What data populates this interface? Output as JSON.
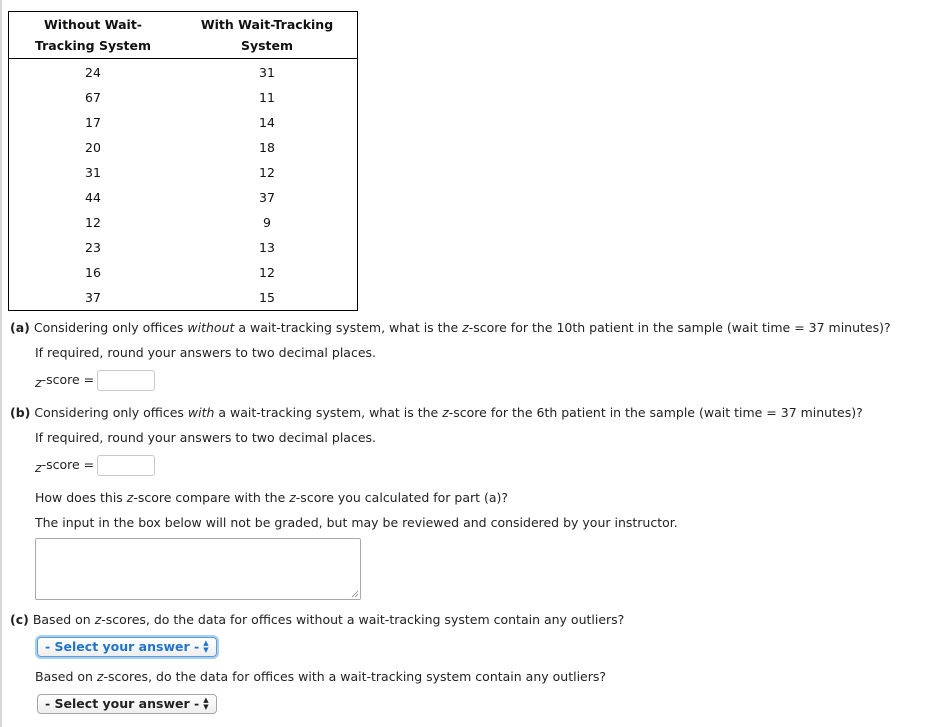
{
  "table": {
    "headers": [
      "Without Wait-\nTracking System",
      "With Wait-Tracking\nSystem"
    ],
    "header_lines": [
      [
        "Without Wait-",
        "Tracking System"
      ],
      [
        "With Wait-Tracking",
        "System"
      ]
    ],
    "rows": [
      [
        "24",
        "31"
      ],
      [
        "67",
        "11"
      ],
      [
        "17",
        "14"
      ],
      [
        "20",
        "18"
      ],
      [
        "31",
        "12"
      ],
      [
        "44",
        "37"
      ],
      [
        "12",
        "9"
      ],
      [
        "23",
        "13"
      ],
      [
        "16",
        "12"
      ],
      [
        "37",
        "15"
      ]
    ]
  },
  "part_a": {
    "label": "(a)",
    "question_pre": " Considering only offices ",
    "question_em": "without",
    "question_mid": " a wait-tracking system, what is the ",
    "question_z": "z",
    "question_post": "-score for the 10th patient in the sample (wait time = 37 minutes)?",
    "rounding_note": "If required, round your answers to two decimal places.",
    "z_label_z": "z",
    "z_label_rest": "-score =",
    "answer_value": ""
  },
  "part_b": {
    "label": "(b)",
    "question_pre": " Considering only offices ",
    "question_em": "with",
    "question_mid": " a wait-tracking system, what is the ",
    "question_z": "z",
    "question_post": "-score for the 6th patient in the sample (wait time = 37 minutes)?",
    "rounding_note": "If required, round your answers to two decimal places.",
    "z_label_z": "z",
    "z_label_rest": "-score =",
    "answer_value": "",
    "compare_pre": "How does this ",
    "compare_z1": "z",
    "compare_mid": "-score compare with the ",
    "compare_z2": "z",
    "compare_post": "-score you calculated for part (a)?",
    "ungraded_note": "The input in the box below will not be graded, but may be reviewed and considered by your instructor.",
    "comment_value": ""
  },
  "part_c": {
    "label": "(c)",
    "q1_pre": " Based on ",
    "q1_z": "z",
    "q1_post": "-scores, do the data for offices without a wait-tracking system contain any outliers?",
    "select1_value": "- Select your answer -",
    "q2_pre": "Based on ",
    "q2_z": "z",
    "q2_post": "-scores, do the data for offices with a wait-tracking system contain any outliers?",
    "select2_value": "- Select your answer -",
    "arrows_glyph": "▲▼"
  },
  "colors": {
    "focus_blue": "#1f74c9",
    "focus_ring": "#a8cff0"
  }
}
